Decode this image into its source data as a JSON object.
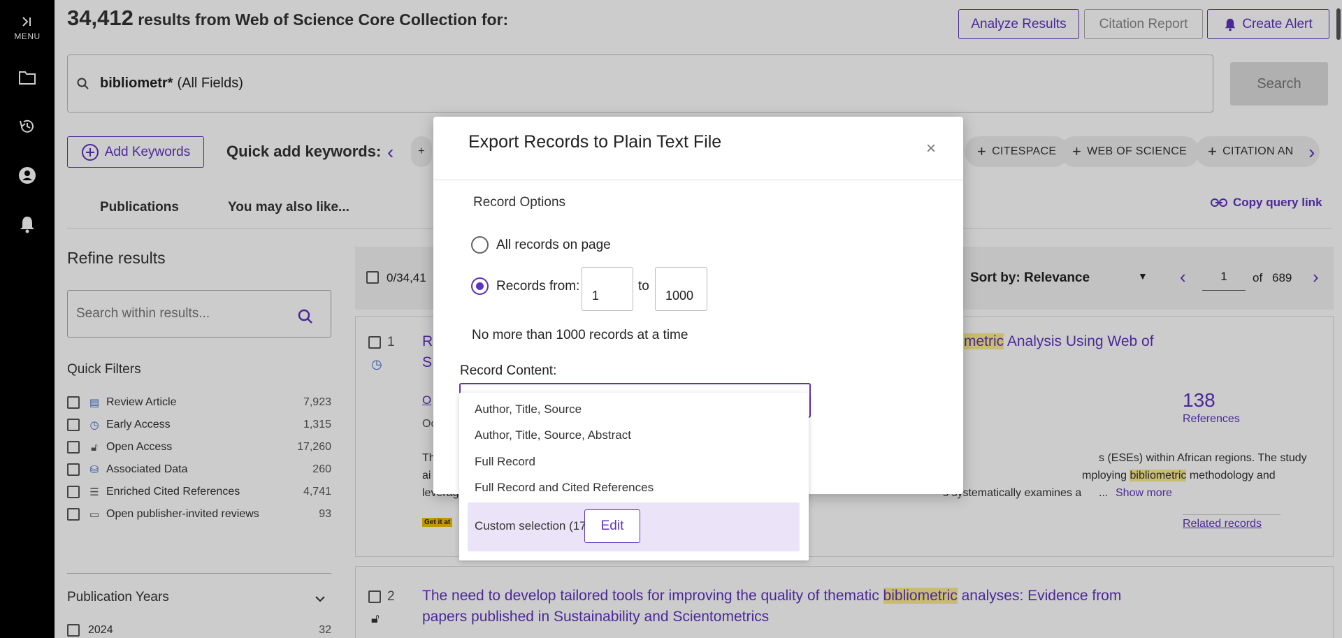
{
  "sidebar": {
    "menu_label": "MENU",
    "icons": [
      "folder-icon",
      "history-icon",
      "account-icon",
      "bell-icon"
    ]
  },
  "header": {
    "results_count": "34,412",
    "results_text": "results from Web of Science Core Collection for:",
    "analyze_label": "Analyze Results",
    "citation_label": "Citation Report",
    "alert_label": "Create Alert"
  },
  "search": {
    "term": "bibliometr*",
    "field": "(All Fields)",
    "button_label": "Search"
  },
  "keywords": {
    "add_label": "Add Keywords",
    "quick_add_label": "Quick add keywords:",
    "chips": [
      "CITESPACE",
      "WEB OF SCIENCE",
      "CITATION AN"
    ]
  },
  "tabs": {
    "publications": "Publications",
    "also_like": "You may also like...",
    "copy_link": "Copy query link"
  },
  "refine": {
    "title": "Refine results",
    "search_placeholder": "Search within results...",
    "quick_filters_title": "Quick Filters",
    "filters": [
      {
        "label": "Review Article",
        "count": "7,923"
      },
      {
        "label": "Early Access",
        "count": "1,315"
      },
      {
        "label": "Open Access",
        "count": "17,260"
      },
      {
        "label": "Associated Data",
        "count": "260"
      },
      {
        "label": "Enriched Cited References",
        "count": "4,741"
      },
      {
        "label": "Open publisher-invited reviews",
        "count": "93"
      }
    ],
    "pub_years_title": "Publication Years",
    "year_row": {
      "label": "2024",
      "count": "32"
    }
  },
  "results_bar": {
    "selected": "0/34,41",
    "sort_label": "Sort by: Relevance",
    "page": "1",
    "of_label": "of",
    "total_pages": "689"
  },
  "result1": {
    "index": "1",
    "title_start": "R",
    "title_line2_start": "S",
    "title_hl": "metric",
    "title_end": " Analysis Using Web of",
    "refs_count": "138",
    "refs_label": "References",
    "line1_frag": "s (ESEs) within African regions. The study",
    "line2_frag_a": "mploying ",
    "line2_hl": "bibliometric",
    "line2_frag_b": " methodology and",
    "line3_frag": "s systematically examines a",
    "abstract_start_1": "Th",
    "abstract_start_2": "ai",
    "abstract_start_3": "leverag",
    "oa_frag": "O",
    "oc_frag": "Oc",
    "ellipsis": "...",
    "show_more": "Show more",
    "get_it": "Get it at",
    "related": "Related records"
  },
  "result2": {
    "index": "2",
    "title_a": "The need to develop tailored tools for improving the quality of thematic ",
    "title_hl": "bibliometric",
    "title_b": " analyses: Evidence from",
    "title_line2": "papers published in Sustainability and Scientometrics"
  },
  "modal": {
    "title": "Export Records to Plain Text File",
    "close": "×",
    "record_options": "Record Options",
    "all_records": "All records on page",
    "records_from": "Records from:",
    "from_value": "1",
    "to_label": "to",
    "to_value": "1000",
    "no_more": "No more than 1000 records at a time",
    "record_content": "Record Content:"
  },
  "dropdown": {
    "items": [
      "Author, Title, Source",
      "Author, Title, Source, Abstract",
      "Full Record",
      "Full Record and Cited References"
    ],
    "custom": "Custom selection (17)",
    "edit": "Edit"
  },
  "colors": {
    "accent": "#5e33bf",
    "highlight": "#fbeb8d",
    "sidebar": "#000000"
  }
}
